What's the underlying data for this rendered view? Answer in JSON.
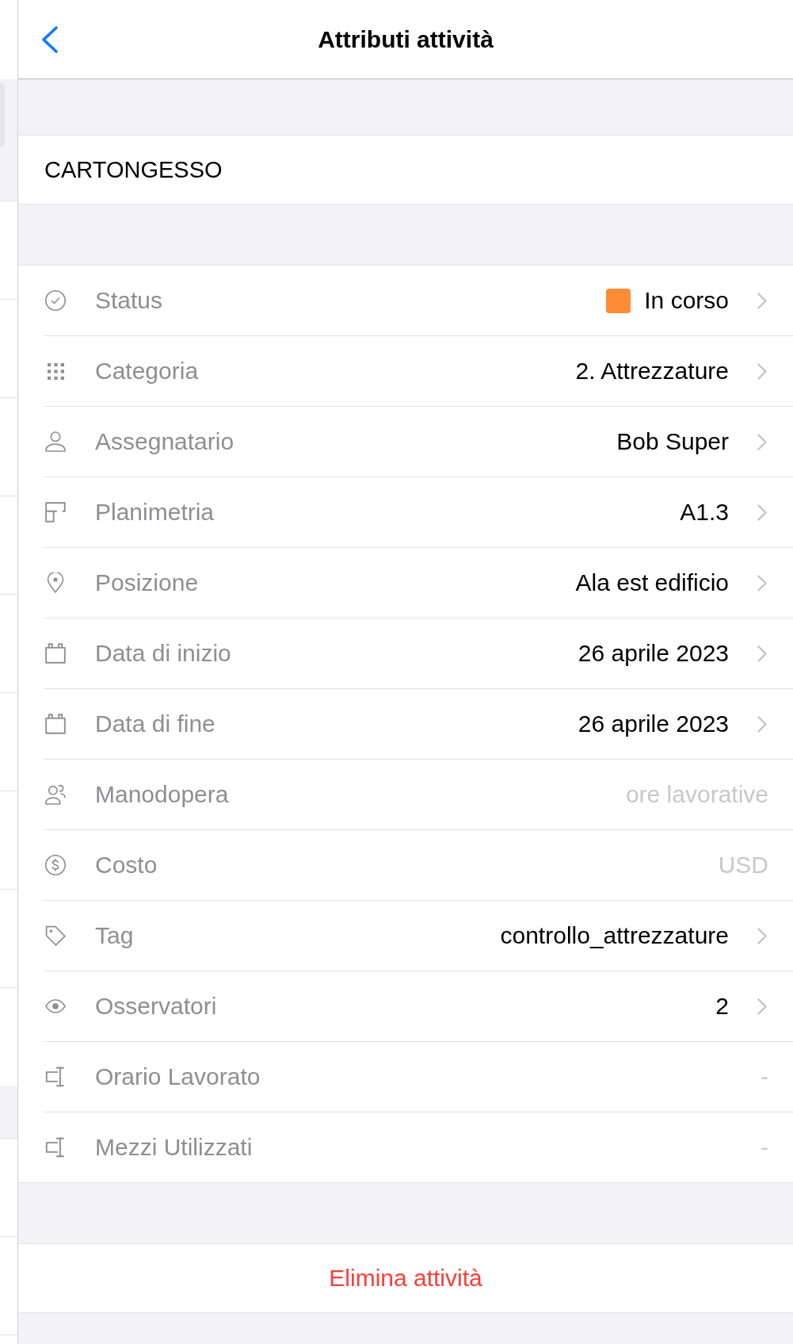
{
  "navigation_bar": {
    "title": "Attributi attività"
  },
  "task_name": "CARTONGESSO",
  "attributes": [
    {
      "kind": "select",
      "label": "Status",
      "value": "In corso",
      "color": "#fd8c34"
    },
    {
      "kind": "select",
      "label": "Categoria",
      "value": "2. Attrezzature"
    },
    {
      "kind": "select",
      "label": "Assegnatario",
      "value": "Bob Super"
    },
    {
      "kind": "select",
      "label": "Planimetria",
      "value": "A1.3"
    },
    {
      "kind": "select",
      "label": "Posizione",
      "value": "Ala est edificio"
    },
    {
      "kind": "select",
      "label": "Data di inizio",
      "value": "26 aprile 2023"
    },
    {
      "kind": "select",
      "label": "Data di fine",
      "value": "26 aprile 2023"
    },
    {
      "kind": "input",
      "label": "Manodopera",
      "placeholder": "ore lavorative"
    },
    {
      "kind": "input",
      "label": "Costo",
      "placeholder": "USD"
    },
    {
      "kind": "select",
      "label": "Tag",
      "value": "controllo_attrezzature"
    },
    {
      "kind": "select",
      "label": "Osservatori",
      "value": "2"
    },
    {
      "kind": "empty",
      "label": "Orario Lavorato",
      "value": "-"
    },
    {
      "kind": "empty",
      "label": "Mezzi Utilizzati",
      "value": "-"
    }
  ],
  "delete_button": "Elimina attività"
}
